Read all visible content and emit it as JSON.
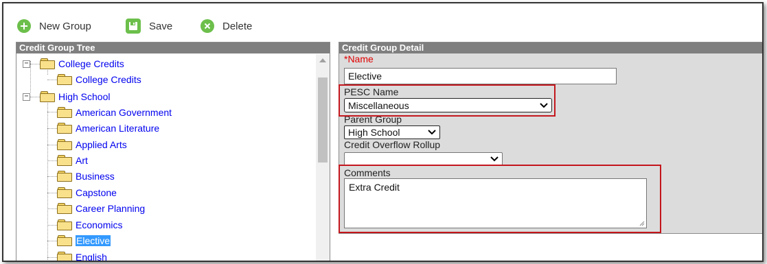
{
  "toolbar": {
    "new_group_label": "New Group",
    "save_label": "Save",
    "delete_label": "Delete",
    "icon_color": "#6cbf4b"
  },
  "tree_panel": {
    "title": "Credit Group Tree",
    "nodes": [
      {
        "label": "College Credits",
        "level": 0,
        "expanded": true
      },
      {
        "label": "College Credits",
        "level": 1
      },
      {
        "label": "High School",
        "level": 0,
        "expanded": true
      },
      {
        "label": "American Government",
        "level": 1
      },
      {
        "label": "American Literature",
        "level": 1
      },
      {
        "label": "Applied Arts",
        "level": 1
      },
      {
        "label": "Art",
        "level": 1
      },
      {
        "label": "Business",
        "level": 1
      },
      {
        "label": "Capstone",
        "level": 1
      },
      {
        "label": "Career Planning",
        "level": 1
      },
      {
        "label": "Economics",
        "level": 1
      },
      {
        "label": "Elective",
        "level": 1,
        "selected": true
      },
      {
        "label": "English",
        "level": 1
      }
    ]
  },
  "detail_panel": {
    "title": "Credit Group Detail",
    "name_label": "*Name",
    "name_value": "Elective",
    "pesc_label": "PESC Name",
    "pesc_value": "Miscellaneous",
    "parent_label": "Parent Group",
    "parent_value": "High School",
    "overflow_label": "Credit Overflow Rollup",
    "overflow_value": "",
    "comments_label": "Comments",
    "comments_value": "Extra Credit",
    "highlight_color": "#c3161c"
  }
}
